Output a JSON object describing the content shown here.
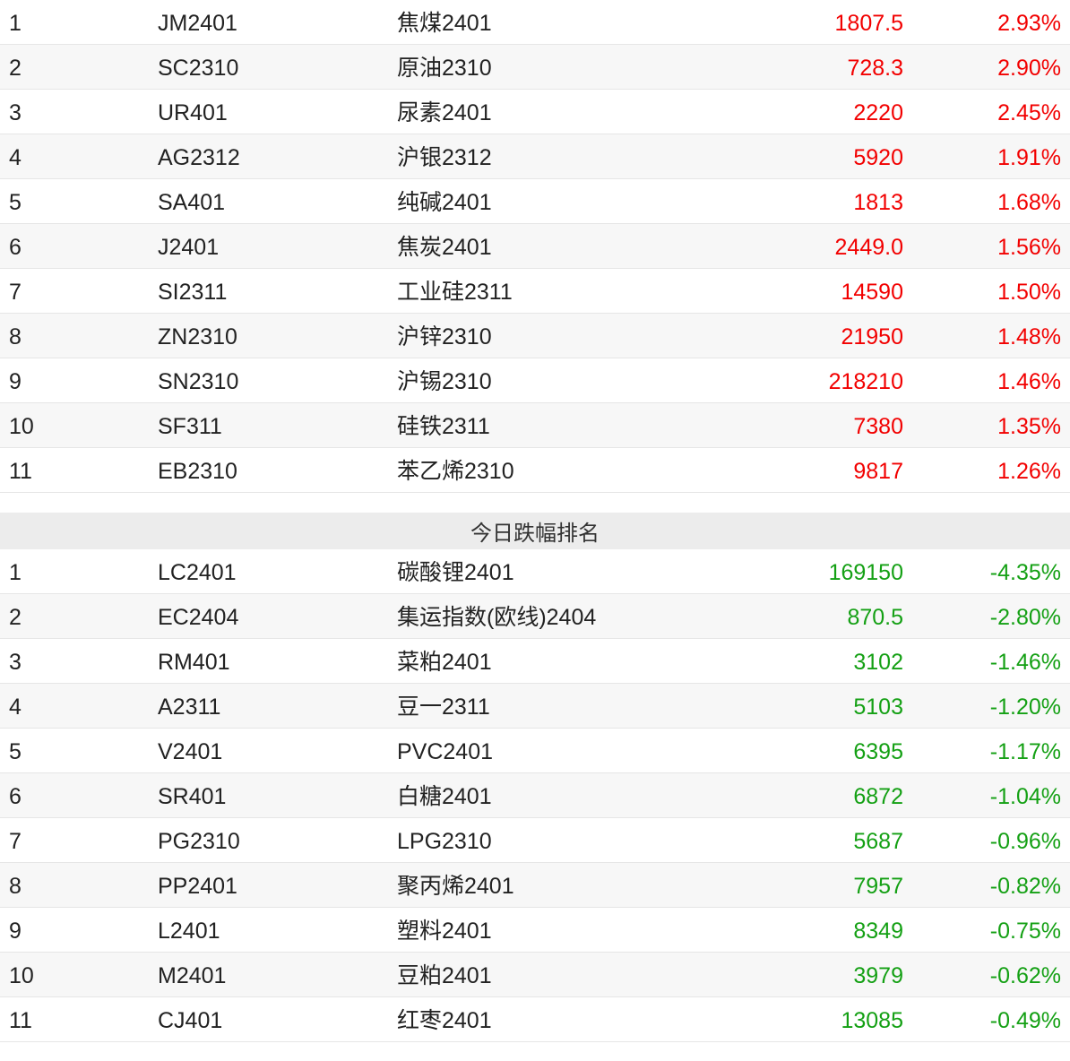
{
  "colors": {
    "up": "#f20000",
    "down": "#14a014",
    "header_bg": "#ececec",
    "row_alt_bg": "#f7f7f7"
  },
  "gainers": {
    "rows": [
      {
        "rank": "1",
        "code": "JM2401",
        "name": "焦煤2401",
        "price": "1807.5",
        "change": "2.93%"
      },
      {
        "rank": "2",
        "code": "SC2310",
        "name": "原油2310",
        "price": "728.3",
        "change": "2.90%"
      },
      {
        "rank": "3",
        "code": "UR401",
        "name": "尿素2401",
        "price": "2220",
        "change": "2.45%"
      },
      {
        "rank": "4",
        "code": "AG2312",
        "name": "沪银2312",
        "price": "5920",
        "change": "1.91%"
      },
      {
        "rank": "5",
        "code": "SA401",
        "name": "纯碱2401",
        "price": "1813",
        "change": "1.68%"
      },
      {
        "rank": "6",
        "code": "J2401",
        "name": "焦炭2401",
        "price": "2449.0",
        "change": "1.56%"
      },
      {
        "rank": "7",
        "code": "SI2311",
        "name": "工业硅2311",
        "price": "14590",
        "change": "1.50%"
      },
      {
        "rank": "8",
        "code": "ZN2310",
        "name": "沪锌2310",
        "price": "21950",
        "change": "1.48%"
      },
      {
        "rank": "9",
        "code": "SN2310",
        "name": "沪锡2310",
        "price": "218210",
        "change": "1.46%"
      },
      {
        "rank": "10",
        "code": "SF311",
        "name": "硅铁2311",
        "price": "7380",
        "change": "1.35%"
      },
      {
        "rank": "11",
        "code": "EB2310",
        "name": "苯乙烯2310",
        "price": "9817",
        "change": "1.26%"
      }
    ]
  },
  "losers": {
    "title": "今日跌幅排名",
    "rows": [
      {
        "rank": "1",
        "code": "LC2401",
        "name": "碳酸锂2401",
        "price": "169150",
        "change": "-4.35%"
      },
      {
        "rank": "2",
        "code": "EC2404",
        "name": "集运指数(欧线)2404",
        "price": "870.5",
        "change": "-2.80%"
      },
      {
        "rank": "3",
        "code": "RM401",
        "name": "菜粕2401",
        "price": "3102",
        "change": "-1.46%"
      },
      {
        "rank": "4",
        "code": "A2311",
        "name": "豆一2311",
        "price": "5103",
        "change": "-1.20%"
      },
      {
        "rank": "5",
        "code": "V2401",
        "name": "PVC2401",
        "price": "6395",
        "change": "-1.17%"
      },
      {
        "rank": "6",
        "code": "SR401",
        "name": "白糖2401",
        "price": "6872",
        "change": "-1.04%"
      },
      {
        "rank": "7",
        "code": "PG2310",
        "name": "LPG2310",
        "price": "5687",
        "change": "-0.96%"
      },
      {
        "rank": "8",
        "code": "PP2401",
        "name": "聚丙烯2401",
        "price": "7957",
        "change": "-0.82%"
      },
      {
        "rank": "9",
        "code": "L2401",
        "name": "塑料2401",
        "price": "8349",
        "change": "-0.75%"
      },
      {
        "rank": "10",
        "code": "M2401",
        "name": "豆粕2401",
        "price": "3979",
        "change": "-0.62%"
      },
      {
        "rank": "11",
        "code": "CJ401",
        "name": "红枣2401",
        "price": "13085",
        "change": "-0.49%"
      }
    ]
  }
}
